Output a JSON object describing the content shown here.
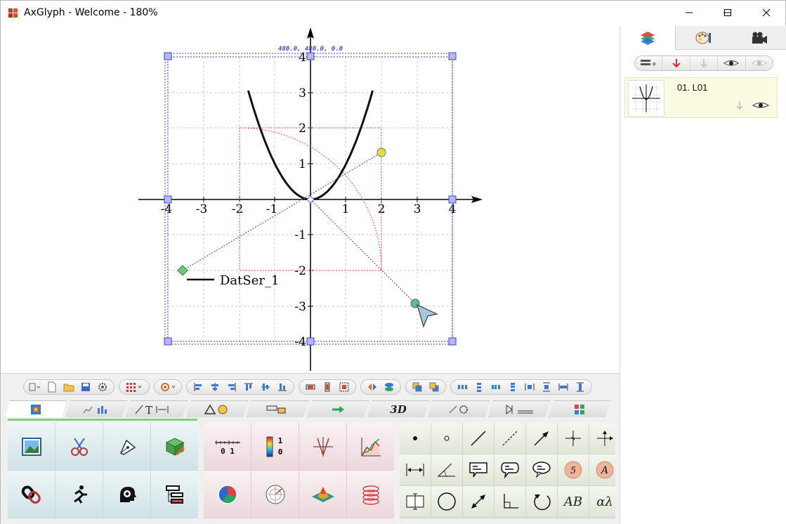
{
  "window": {
    "title": "AxGlyph - Welcome - 180%"
  },
  "canvas": {
    "selection_readout": "480.0, 480.0, 0.0",
    "legend_label": "DatSer_1",
    "x_ticks": [
      "-4",
      "-3",
      "-2",
      "-1",
      "1",
      "2",
      "3",
      "4"
    ],
    "y_ticks": [
      "4",
      "3",
      "2",
      "1",
      "-1",
      "-2",
      "-3",
      "-4"
    ]
  },
  "right_panel": {
    "tabs": [
      "layers-icon",
      "palette-icon",
      "camera-icon"
    ],
    "layer": {
      "name": "01. L01"
    }
  },
  "bottom": {
    "category_tabs": [
      "image",
      "chart",
      "line-text",
      "shapes",
      "tools",
      "arrow",
      "3D",
      "misc",
      "circuit",
      "grid"
    ],
    "tab_3d_label": "3D",
    "text_tool_AB": "AB",
    "text_tool_alpha": "αλ",
    "number_badge": "5",
    "letter_badge": "A",
    "ruler_label": "0 1",
    "colorbar_label_top": "1",
    "colorbar_label_bottom": "0"
  },
  "chart_data": {
    "type": "line",
    "series": [
      {
        "name": "DatSer_1",
        "function": "y = x^2",
        "x_range": [
          -1.75,
          1.75
        ]
      }
    ],
    "xlim": [
      -4,
      4
    ],
    "ylim": [
      -4,
      4
    ],
    "grid": true,
    "legend_position": "bottom-left"
  }
}
